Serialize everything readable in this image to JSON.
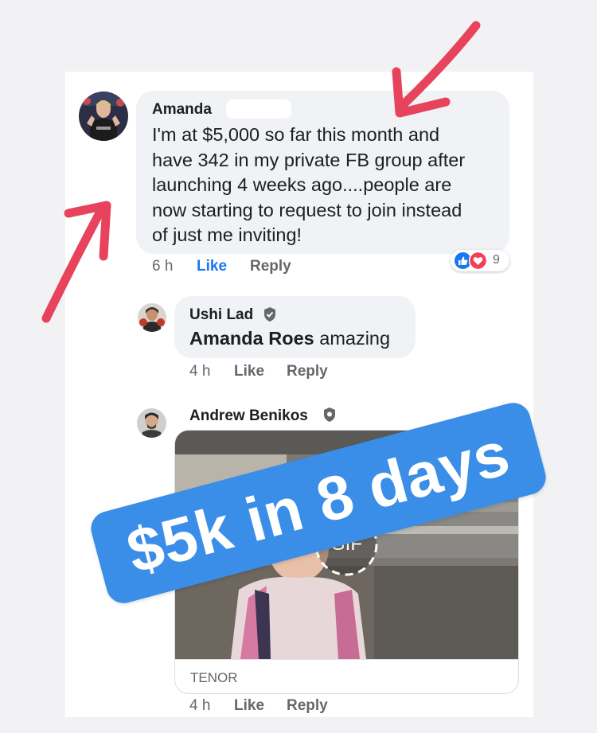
{
  "thread": {
    "main_comment": {
      "author": "Amanda",
      "text": "I'm at $5,000 so far this month and have 342 in my private FB group after launching 4 weeks ago....people are now starting to request to join instead of just me inviting!",
      "lines": [
        "I'm at $5,000 so far this month and",
        "have 342 in my private FB group after",
        "launching 4 weeks ago....people are",
        "now starting to request to join instead",
        "of just me inviting!"
      ],
      "time": "6 h",
      "like_label": "Like",
      "reply_label": "Reply",
      "reaction_count": "9",
      "reaction_icons": [
        "like-icon",
        "love-icon"
      ]
    },
    "replies": [
      {
        "author": "Ushi Lad",
        "mention": "Amanda Roes",
        "text": "amazing",
        "time": "4 h",
        "like_label": "Like",
        "reply_label": "Reply"
      },
      {
        "author": "Andrew Benikos",
        "gif_badge": "GIF",
        "gif_source": "TENOR",
        "time": "4 h",
        "like_label": "Like",
        "reply_label": "Reply"
      }
    ]
  },
  "overlay": {
    "banner_text": "$5k in 8 days",
    "banner_color": "#3a8ee8",
    "arrow_color": "#e8435c"
  },
  "colors": {
    "link_blue": "#1877f2",
    "meta_gray": "#65676b",
    "bubble_bg": "#f0f2f5"
  }
}
